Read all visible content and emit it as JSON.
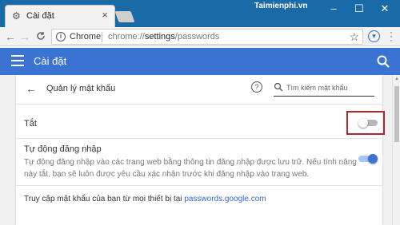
{
  "browser": {
    "tab_title": "Cài đặt",
    "tab_close": "×",
    "watermark": "Taimienphi.vn",
    "window_buttons": {
      "minimize": "–",
      "maximize": "☐",
      "close": "✕"
    },
    "nav": {
      "back": "←",
      "forward": "→",
      "reload": "C"
    },
    "omnibox": {
      "scheme_label": "Chrome",
      "url_prefix": "chrome://",
      "url_path_bold": "settings",
      "url_suffix": "/passwords"
    }
  },
  "header": {
    "title": "Cài đặt"
  },
  "passwords": {
    "title": "Quản lý mật khẩu",
    "search_placeholder": "Tìm kiếm mật khẩu",
    "offer_save": {
      "label": "Tắt",
      "enabled": false
    },
    "auto_signin": {
      "title": "Tự động đăng nhập",
      "description": "Tự động đăng nhập vào các trang web bằng thông tin đăng nhập được lưu trữ. Nếu tính năng này tắt, bạn sẽ luôn được yêu cầu xác nhận trước khi đăng nhập vào trang web.",
      "enabled": true
    },
    "access": {
      "text": "Truy cập mật khẩu của bạn từ mọi thiết bị tại ",
      "link": "passwords.google.com"
    }
  },
  "colors": {
    "accent": "#3a73d2",
    "highlight_border": "#b0262b",
    "titlebar": "#1a6aa8"
  }
}
